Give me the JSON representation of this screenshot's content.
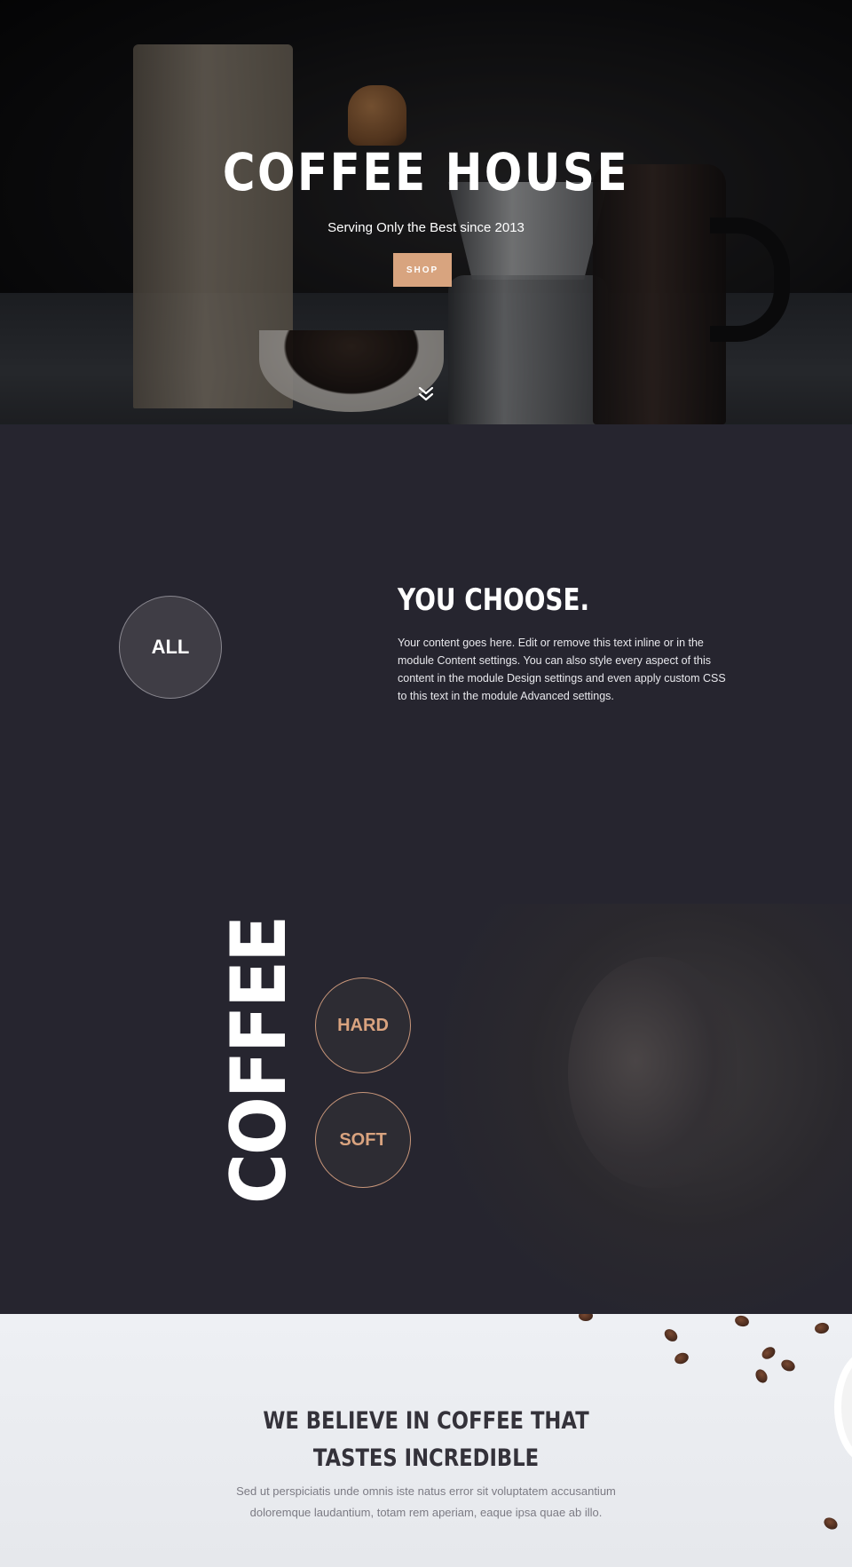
{
  "hero": {
    "title": "COFFEE HOUSE",
    "subtitle": "Serving Only the Best since 2013",
    "shop_label": "SHOP",
    "scroll_icon": "double-chevron-down-icon",
    "accent_color": "#d8a47f"
  },
  "choose": {
    "circle_label": "ALL",
    "title": "YOU CHOOSE.",
    "text": "Your content goes here. Edit or remove this text inline or in the module Content settings. You can also style every aspect of this content in the module Design settings and even apply custom CSS to this text in the module Advanced settings.",
    "vertical_word": "COFFEE",
    "options": [
      "HARD",
      "SOFT"
    ]
  },
  "believe": {
    "title": "WE BELIEVE IN COFFEE THAT TASTES INCREDIBLE",
    "text": "Sed ut perspiciatis unde omnis iste natus error sit voluptatem accusantium doloremque laudantium, totam rem aperiam, eaque ipsa quae ab illo."
  }
}
